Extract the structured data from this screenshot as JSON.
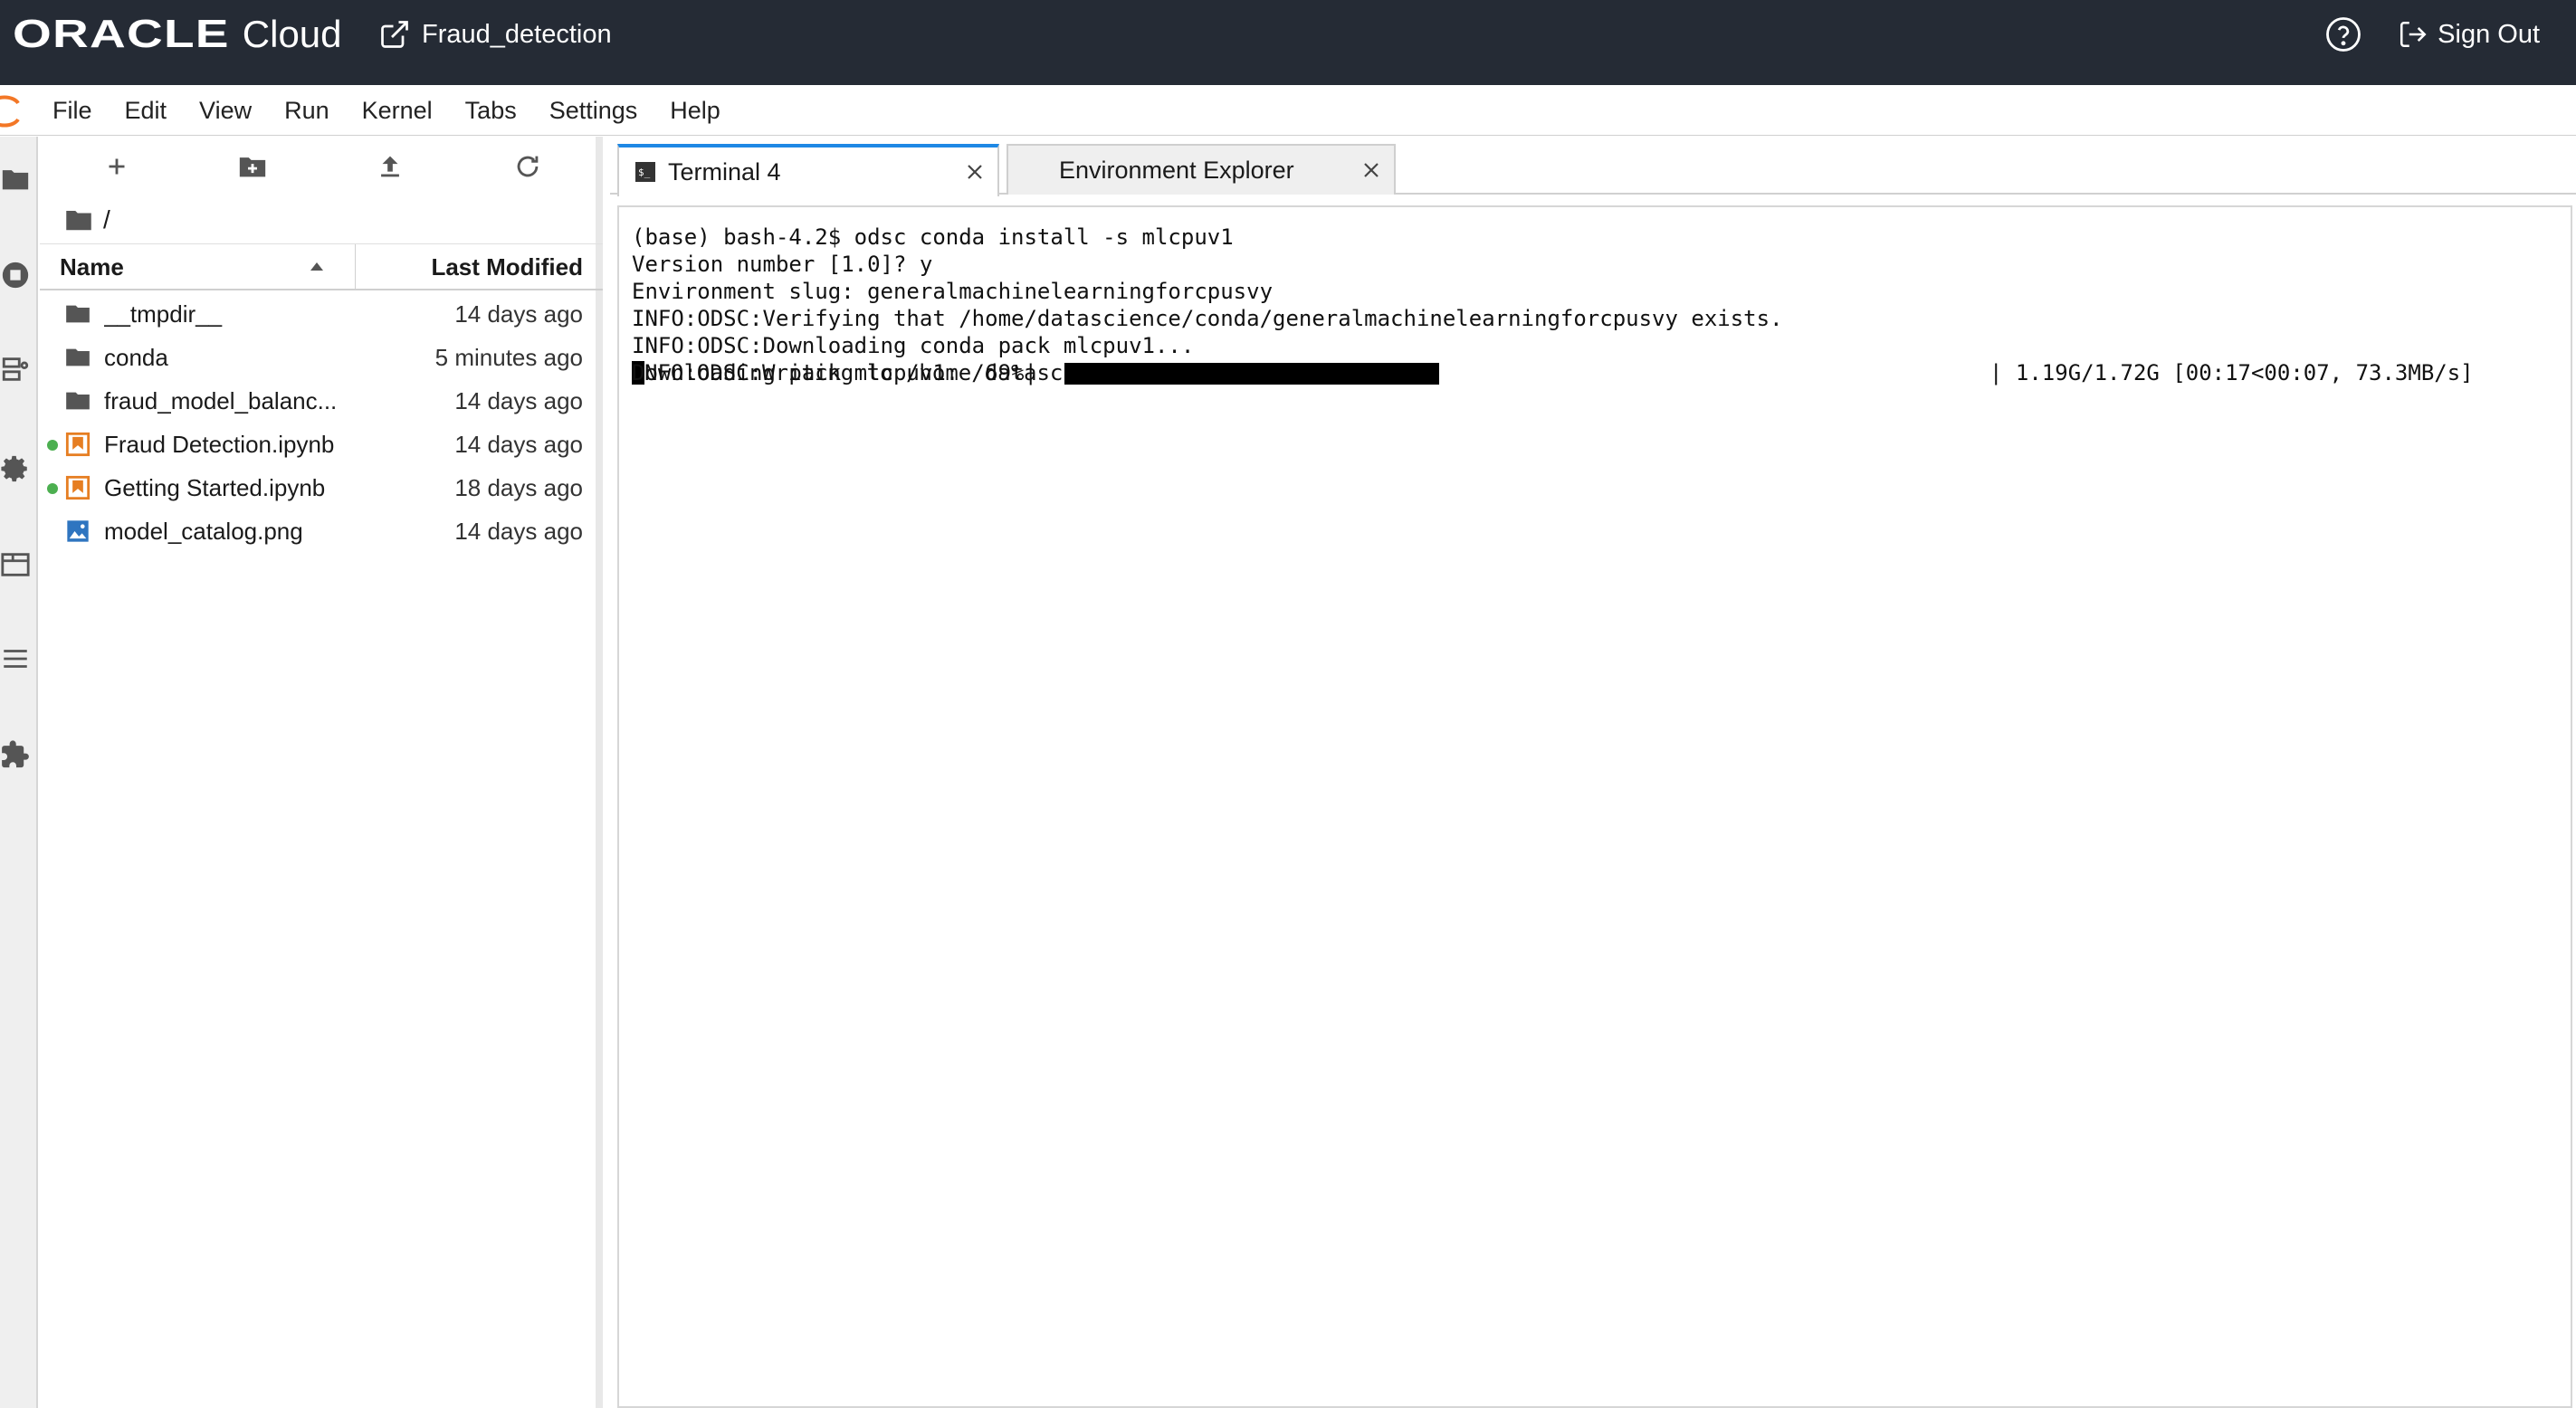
{
  "header": {
    "brand_oracle": "ORACLE",
    "brand_cloud": "Cloud",
    "project_name": "Fraud_detection",
    "sign_out": "Sign Out"
  },
  "menu": {
    "items": [
      "File",
      "Edit",
      "View",
      "Run",
      "Kernel",
      "Tabs",
      "Settings",
      "Help"
    ]
  },
  "filebrowser": {
    "breadcrumb": "/",
    "col_name": "Name",
    "col_modified": "Last Modified",
    "files": [
      {
        "name": "__tmpdir__",
        "modified": "14 days ago",
        "type": "folder",
        "running": false
      },
      {
        "name": "conda",
        "modified": "5 minutes ago",
        "type": "folder",
        "running": false
      },
      {
        "name": "fraud_model_balanc...",
        "modified": "14 days ago",
        "type": "folder",
        "running": false
      },
      {
        "name": "Fraud Detection.ipynb",
        "modified": "14 days ago",
        "type": "notebook",
        "running": true
      },
      {
        "name": "Getting Started.ipynb",
        "modified": "18 days ago",
        "type": "notebook",
        "running": true
      },
      {
        "name": "model_catalog.png",
        "modified": "14 days ago",
        "type": "image",
        "running": false
      }
    ]
  },
  "tabs": [
    {
      "label": "Terminal 4",
      "active": true,
      "icon": "terminal-icon"
    },
    {
      "label": "Environment Explorer",
      "active": false,
      "icon": ""
    }
  ],
  "terminal": {
    "lines": [
      "(base) bash-4.2$ odsc conda install -s mlcpuv1",
      "Version number [1.0]? y",
      "Environment slug: generalmachinelearningforcpusvy",
      "INFO:ODSC:Verifying that /home/datascience/conda/generalmachinelearningforcpusvy exists.",
      "INFO:ODSC:Downloading conda pack mlcpuv1...",
      "NFO:ODSC:Writing to /home/datascience/.mlcpuv1.tar.gz"
    ],
    "progress_prefix": "Downloading pack mlcpuv1:  69%|",
    "progress_fraction": 0.41,
    "progress_suffix": "| 1.19G/1.72G [00:17<00:07, 73.3MB/s]"
  },
  "colors": {
    "header_bg": "#252b35",
    "accent": "#1e88e5",
    "notebook_orange": "#e67e22",
    "running_dot": "#4caf50",
    "oracle_red": "#c74634"
  }
}
